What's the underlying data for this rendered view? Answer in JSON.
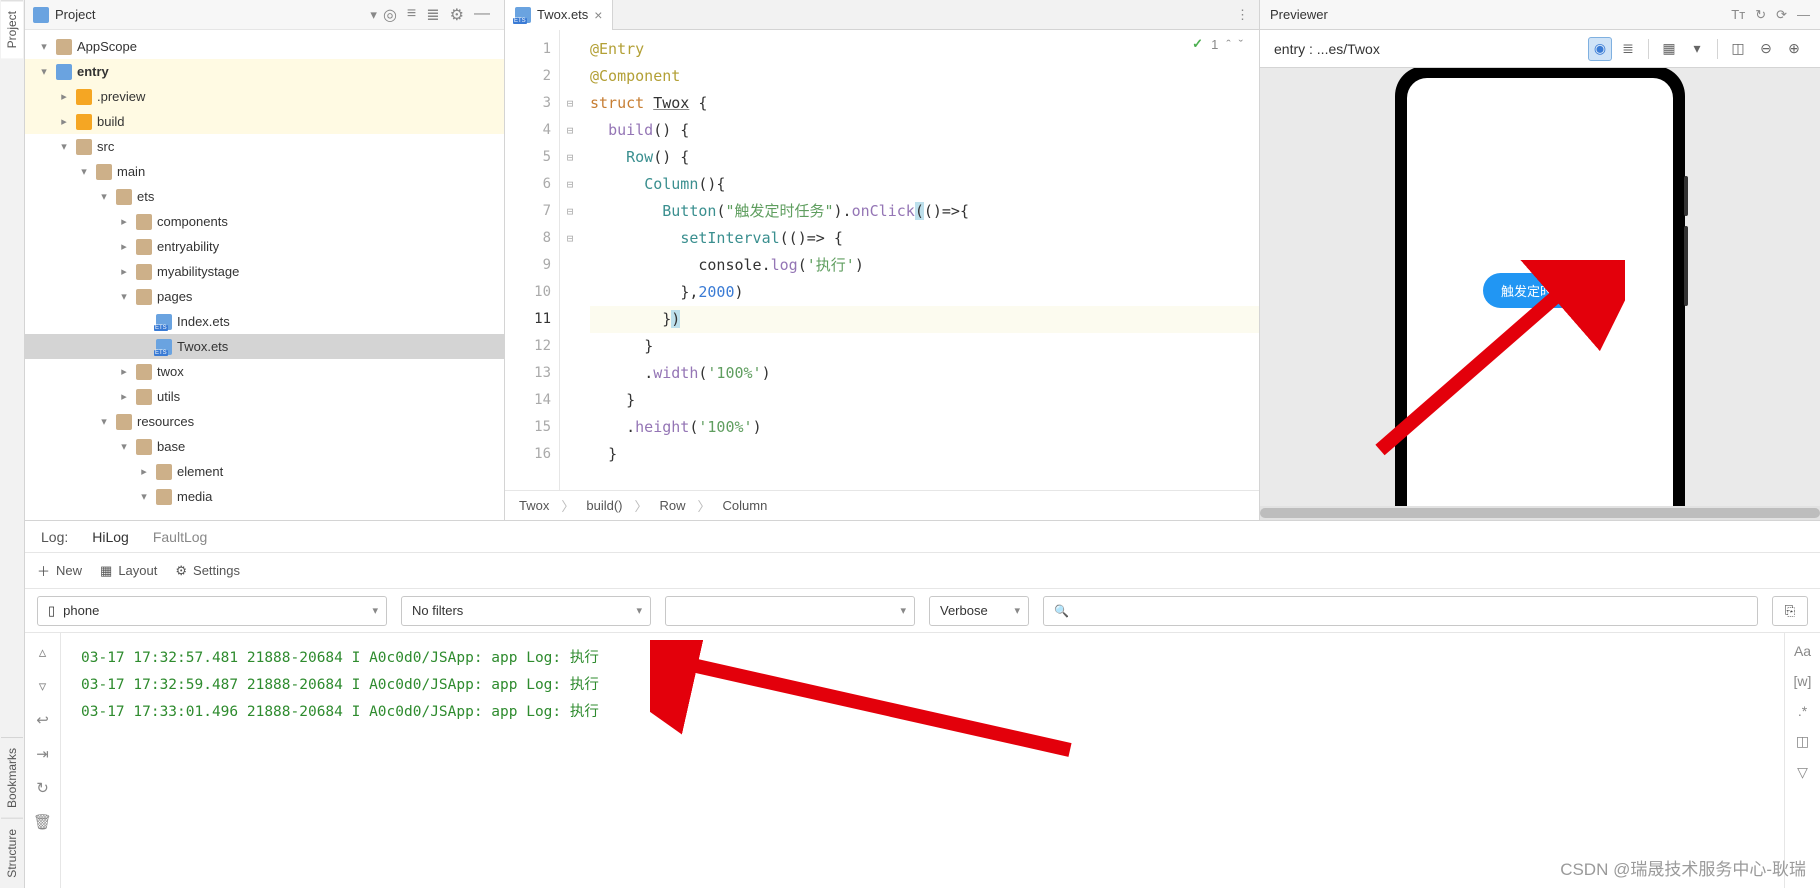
{
  "left_tabs": [
    "Project",
    "Bookmarks",
    "Structure"
  ],
  "project_header": {
    "label": "Project"
  },
  "tree": [
    {
      "depth": 0,
      "chev": "▾",
      "icon": "fold",
      "label": "AppScope"
    },
    {
      "depth": 0,
      "chev": "▾",
      "icon": "blue",
      "label": "entry",
      "bold": true,
      "highlight": true
    },
    {
      "depth": 1,
      "chev": "▸",
      "icon": "orange",
      "label": ".preview",
      "highlight": true
    },
    {
      "depth": 1,
      "chev": "▸",
      "icon": "orange",
      "label": "build",
      "highlight": true
    },
    {
      "depth": 1,
      "chev": "▾",
      "icon": "fold",
      "label": "src"
    },
    {
      "depth": 2,
      "chev": "▾",
      "icon": "fold",
      "label": "main"
    },
    {
      "depth": 3,
      "chev": "▾",
      "icon": "fold",
      "label": "ets"
    },
    {
      "depth": 4,
      "chev": "▸",
      "icon": "fold",
      "label": "components"
    },
    {
      "depth": 4,
      "chev": "▸",
      "icon": "fold",
      "label": "entryability"
    },
    {
      "depth": 4,
      "chev": "▸",
      "icon": "fold",
      "label": "myabilitystage"
    },
    {
      "depth": 4,
      "chev": "▾",
      "icon": "fold",
      "label": "pages"
    },
    {
      "depth": 5,
      "chev": "",
      "icon": "file",
      "label": "Index.ets"
    },
    {
      "depth": 5,
      "chev": "",
      "icon": "file",
      "label": "Twox.ets",
      "selected": true
    },
    {
      "depth": 4,
      "chev": "▸",
      "icon": "fold",
      "label": "twox"
    },
    {
      "depth": 4,
      "chev": "▸",
      "icon": "fold",
      "label": "utils"
    },
    {
      "depth": 3,
      "chev": "▾",
      "icon": "fold",
      "label": "resources"
    },
    {
      "depth": 4,
      "chev": "▾",
      "icon": "fold",
      "label": "base"
    },
    {
      "depth": 5,
      "chev": "▸",
      "icon": "fold",
      "label": "element"
    },
    {
      "depth": 5,
      "chev": "▾",
      "icon": "fold",
      "label": "media"
    }
  ],
  "editor": {
    "tab_label": "Twox.ets",
    "status_count": "1",
    "lines": 16,
    "breadcrumb": [
      "Twox",
      "build()",
      "Row",
      "Column"
    ]
  },
  "code_lines": [
    {
      "n": 1,
      "html": "<span class='dec'>@Entry</span>"
    },
    {
      "n": 2,
      "html": "<span class='dec'>@Component</span>"
    },
    {
      "n": 3,
      "html": "<span class='kw'>struct</span> <span class='ident underl'>Twox</span> <span class='punc'>{</span>"
    },
    {
      "n": 4,
      "html": "  <span class='fn'>build</span><span class='punc'>() {</span>"
    },
    {
      "n": 5,
      "html": "    <span class='fncall'>Row</span><span class='punc'>() {</span>"
    },
    {
      "n": 6,
      "html": "      <span class='fncall'>Column</span><span class='punc'>(){</span>"
    },
    {
      "n": 7,
      "html": "        <span class='fncall'>Button</span><span class='punc'>(</span><span class='str'>\"触发定时任务\"</span><span class='punc'>).</span><span class='fn'>onClick</span><span class='cursor-bg'>(</span><span class='punc'>()=&gt;{</span>"
    },
    {
      "n": 8,
      "html": "          <span class='fncall'>setInterval</span><span class='punc'>(()=&gt; {</span>"
    },
    {
      "n": 9,
      "html": "            <span class='ident'>console</span><span class='punc'>.</span><span class='fn'>log</span><span class='punc'>(</span><span class='str'>'执行'</span><span class='punc'>)</span>"
    },
    {
      "n": 10,
      "html": "          <span class='punc'>},</span><span class='num'>2000</span><span class='punc'>)</span>"
    },
    {
      "n": 11,
      "html": "        <span class='punc'>}</span><span class='cursor-bg'>)</span>",
      "hl": true
    },
    {
      "n": 12,
      "html": "      <span class='punc'>}</span>"
    },
    {
      "n": 13,
      "html": "      <span class='punc'>.</span><span class='fn'>width</span><span class='punc'>(</span><span class='str'>'100%'</span><span class='punc'>)</span>"
    },
    {
      "n": 14,
      "html": "    <span class='punc'>}</span>"
    },
    {
      "n": 15,
      "html": "    <span class='punc'>.</span><span class='fn'>height</span><span class='punc'>(</span><span class='str'>'100%'</span><span class='punc'>)</span>"
    },
    {
      "n": 16,
      "html": "  <span class='punc'>}</span>"
    }
  ],
  "previewer": {
    "title": "Previewer",
    "path": "entry : ...es/Twox",
    "button_label": "触发定时任务"
  },
  "log": {
    "header_label": "Log:",
    "tabs": [
      "HiLog",
      "FaultLog"
    ],
    "toolbar": {
      "new": "New",
      "layout": "Layout",
      "settings": "Settings"
    },
    "device": "phone",
    "filter": "No filters",
    "level": "Verbose",
    "lines": [
      "03-17 17:32:57.481 21888-20684 I A0c0d0/JSApp: app Log: 执行",
      "03-17 17:32:59.487 21888-20684 I A0c0d0/JSApp: app Log: 执行",
      "03-17 17:33:01.496 21888-20684 I A0c0d0/JSApp: app Log: 执行"
    ]
  },
  "watermark": "CSDN @瑞晟技术服务中心-耿瑞"
}
